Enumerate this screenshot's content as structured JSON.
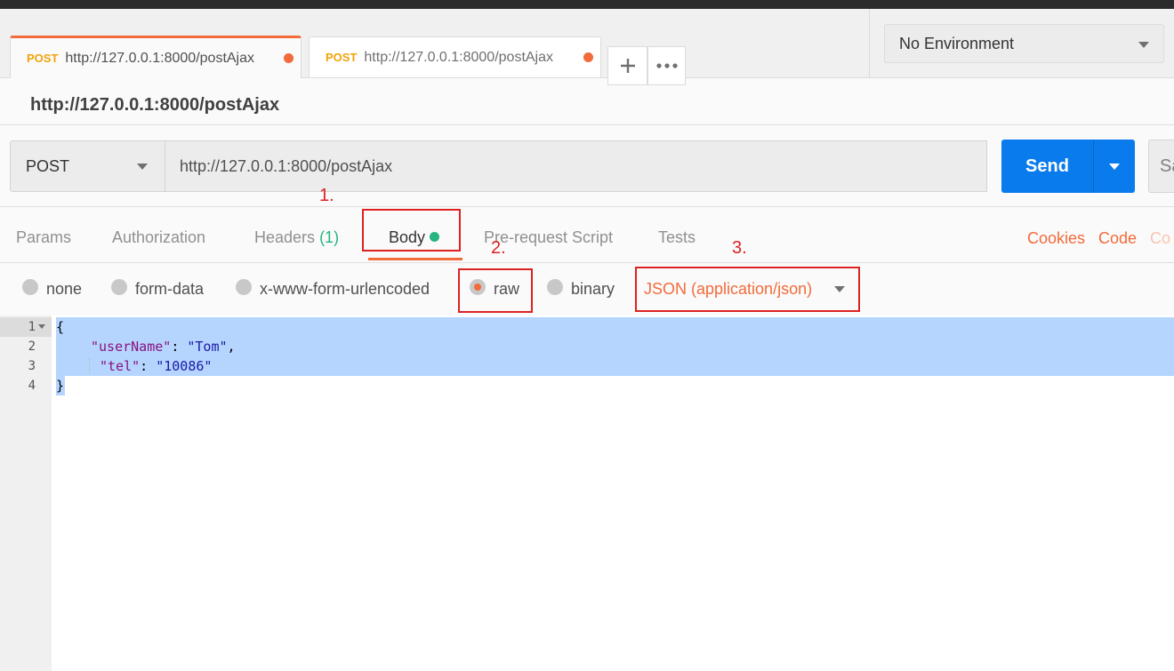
{
  "tabs": [
    {
      "method": "POST",
      "url": "http://127.0.0.1:8000/postAjax",
      "active": true
    },
    {
      "method": "POST",
      "url": "http://127.0.0.1:8000/postAjax",
      "active": false
    }
  ],
  "tab_actions": {
    "new_tab_icon": "plus-icon",
    "more_icon": "more-horizontal-icon"
  },
  "environment": {
    "selected": "No Environment"
  },
  "request": {
    "name": "http://127.0.0.1:8000/postAjax",
    "method": "POST",
    "url": "http://127.0.0.1:8000/postAjax",
    "send_label": "Send",
    "save_label": "Sa"
  },
  "subtabs": [
    {
      "label": "Params"
    },
    {
      "label": "Authorization"
    },
    {
      "label": "Headers",
      "count": "(1)"
    },
    {
      "label": "Body",
      "active": true
    },
    {
      "label": "Pre-request Script"
    },
    {
      "label": "Tests"
    }
  ],
  "right_links": {
    "cookies": "Cookies",
    "code": "Code",
    "comments": "Co"
  },
  "body_types": [
    {
      "label": "none",
      "selected": false
    },
    {
      "label": "form-data",
      "selected": false
    },
    {
      "label": "x-www-form-urlencoded",
      "selected": false
    },
    {
      "label": "raw",
      "selected": true
    },
    {
      "label": "binary",
      "selected": false
    }
  ],
  "content_type": "JSON (application/json)",
  "annotations": {
    "a1": "1.",
    "a2": "2.",
    "a3": "3."
  },
  "editor": {
    "line_numbers": [
      "1",
      "2",
      "3",
      "4"
    ],
    "line1": "{",
    "line2_key": "\"userName\"",
    "line2_sep": ": ",
    "line2_val": "\"Tom\"",
    "line2_end": ",",
    "line3_key": "\"tel\"",
    "line3_sep": ": ",
    "line3_val": "\"10086\"",
    "line4": "}"
  },
  "colors": {
    "accent": "#f26b3a",
    "send": "#097bed",
    "green": "#26b47f",
    "annotation": "#dd2222",
    "selection": "#b5d5ff"
  }
}
